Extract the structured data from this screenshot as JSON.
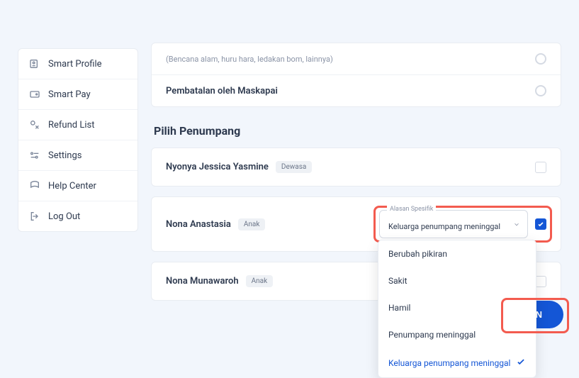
{
  "sidebar": {
    "items": [
      {
        "label": "Smart Profile"
      },
      {
        "label": "Smart Pay"
      },
      {
        "label": "Refund List"
      },
      {
        "label": "Settings"
      },
      {
        "label": "Help Center"
      },
      {
        "label": "Log Out"
      }
    ]
  },
  "reasons": {
    "note": "(Bencana alam, huru hara, ledakan bom, lainnya)",
    "airline_cancel": "Pembatalan oleh Maskapai"
  },
  "passengers_heading": "Pilih Penumpang",
  "passengers": [
    {
      "name": "Nyonya Jessica Yasmine",
      "type": "Dewasa"
    },
    {
      "name": "Nona Anastasia",
      "type": "Anak"
    },
    {
      "name": "Nona Munawaroh",
      "type": "Anak"
    }
  ],
  "select": {
    "label": "Alasan Spesifik",
    "value": "Keluarga penumpang meninggal",
    "options": [
      "Berubah pikiran",
      "Sakit",
      "Hamil",
      "Penumpang meninggal",
      "Keluarga penumpang meninggal"
    ]
  },
  "continue_label": "UTKAN"
}
